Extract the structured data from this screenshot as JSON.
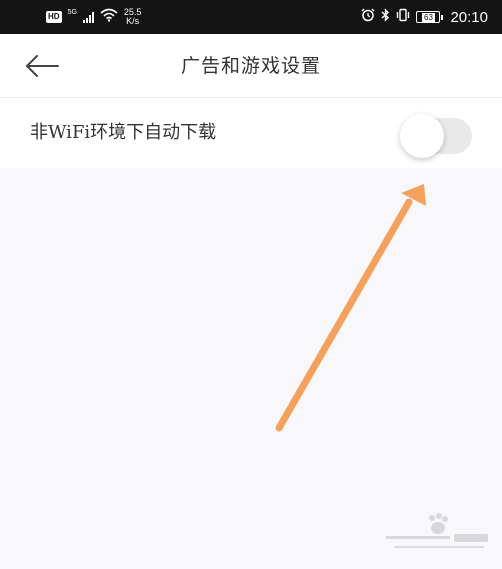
{
  "status_bar": {
    "hd_badge": "HD",
    "network_generation": "5G",
    "net_speed_value": "25.5",
    "net_speed_unit": "K/s",
    "battery_level": "63",
    "time": "20:10"
  },
  "header": {
    "title": "广告和游戏设置"
  },
  "settings": {
    "wifi_download": {
      "label": "非WiFi环境下自动下载",
      "enabled": false
    }
  },
  "colors": {
    "arrow": "#f4a15e",
    "toggle_track_off": "#e9e9e9",
    "status_bar_bg": "#141414"
  },
  "icons": {
    "back": "arrow-left-icon",
    "wifi": "wifi-icon",
    "alarm": "alarm-icon",
    "bluetooth": "bluetooth-icon",
    "vibrate": "vibrate-icon"
  }
}
